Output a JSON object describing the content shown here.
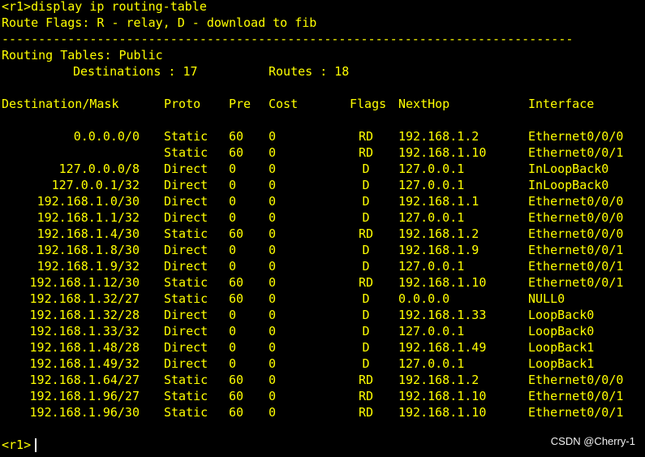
{
  "terminal": {
    "command_line": "<r1>display ip routing-table",
    "flags_line": "Route Flags: R - relay, D - download to fib",
    "separator": "------------------------------------------------------------------------------",
    "table_title": "Routing Tables: Public",
    "destinations_label": "Destinations : 17",
    "routes_label": "Routes : 18",
    "headers": {
      "destination": "Destination/Mask",
      "proto": "Proto",
      "pre": "Pre",
      "cost": "Cost",
      "flags": "Flags",
      "nexthop": "NextHop",
      "interface": "Interface"
    },
    "rows": [
      {
        "destination": "0.0.0.0/0",
        "proto": "Static",
        "pre": "60",
        "cost": "0",
        "flags": "RD",
        "nexthop": "192.168.1.2",
        "interface": "Ethernet0/0/0"
      },
      {
        "destination": "",
        "proto": "Static",
        "pre": "60",
        "cost": "0",
        "flags": "RD",
        "nexthop": "192.168.1.10",
        "interface": "Ethernet0/0/1"
      },
      {
        "destination": "127.0.0.0/8",
        "proto": "Direct",
        "pre": "0",
        "cost": "0",
        "flags": "D",
        "nexthop": "127.0.0.1",
        "interface": "InLoopBack0"
      },
      {
        "destination": "127.0.0.1/32",
        "proto": "Direct",
        "pre": "0",
        "cost": "0",
        "flags": "D",
        "nexthop": "127.0.0.1",
        "interface": "InLoopBack0"
      },
      {
        "destination": "192.168.1.0/30",
        "proto": "Direct",
        "pre": "0",
        "cost": "0",
        "flags": "D",
        "nexthop": "192.168.1.1",
        "interface": "Ethernet0/0/0"
      },
      {
        "destination": "192.168.1.1/32",
        "proto": "Direct",
        "pre": "0",
        "cost": "0",
        "flags": "D",
        "nexthop": "127.0.0.1",
        "interface": "Ethernet0/0/0"
      },
      {
        "destination": "192.168.1.4/30",
        "proto": "Static",
        "pre": "60",
        "cost": "0",
        "flags": "RD",
        "nexthop": "192.168.1.2",
        "interface": "Ethernet0/0/0"
      },
      {
        "destination": "192.168.1.8/30",
        "proto": "Direct",
        "pre": "0",
        "cost": "0",
        "flags": "D",
        "nexthop": "192.168.1.9",
        "interface": "Ethernet0/0/1"
      },
      {
        "destination": "192.168.1.9/32",
        "proto": "Direct",
        "pre": "0",
        "cost": "0",
        "flags": "D",
        "nexthop": "127.0.0.1",
        "interface": "Ethernet0/0/1"
      },
      {
        "destination": "192.168.1.12/30",
        "proto": "Static",
        "pre": "60",
        "cost": "0",
        "flags": "RD",
        "nexthop": "192.168.1.10",
        "interface": "Ethernet0/0/1"
      },
      {
        "destination": "192.168.1.32/27",
        "proto": "Static",
        "pre": "60",
        "cost": "0",
        "flags": "D",
        "nexthop": "0.0.0.0",
        "interface": "NULL0"
      },
      {
        "destination": "192.168.1.32/28",
        "proto": "Direct",
        "pre": "0",
        "cost": "0",
        "flags": "D",
        "nexthop": "192.168.1.33",
        "interface": "LoopBack0"
      },
      {
        "destination": "192.168.1.33/32",
        "proto": "Direct",
        "pre": "0",
        "cost": "0",
        "flags": "D",
        "nexthop": "127.0.0.1",
        "interface": "LoopBack0"
      },
      {
        "destination": "192.168.1.48/28",
        "proto": "Direct",
        "pre": "0",
        "cost": "0",
        "flags": "D",
        "nexthop": "192.168.1.49",
        "interface": "LoopBack1"
      },
      {
        "destination": "192.168.1.49/32",
        "proto": "Direct",
        "pre": "0",
        "cost": "0",
        "flags": "D",
        "nexthop": "127.0.0.1",
        "interface": "LoopBack1"
      },
      {
        "destination": "192.168.1.64/27",
        "proto": "Static",
        "pre": "60",
        "cost": "0",
        "flags": "RD",
        "nexthop": "192.168.1.2",
        "interface": "Ethernet0/0/0"
      },
      {
        "destination": "192.168.1.96/27",
        "proto": "Static",
        "pre": "60",
        "cost": "0",
        "flags": "RD",
        "nexthop": "192.168.1.10",
        "interface": "Ethernet0/0/1"
      },
      {
        "destination": "192.168.1.96/30",
        "proto": "Static",
        "pre": "60",
        "cost": "0",
        "flags": "RD",
        "nexthop": "192.168.1.10",
        "interface": "Ethernet0/0/1"
      }
    ],
    "prompt": "<r1>"
  },
  "watermark": "CSDN @Cherry-1",
  "colors": {
    "background": "#000000",
    "text": "#ffff00",
    "cursor": "#ffffff",
    "watermark": "#f2f2f2"
  }
}
